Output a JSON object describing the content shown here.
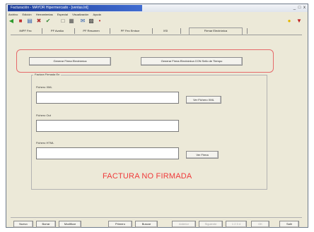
{
  "window": {
    "title": "Facturación - MAYOR Hipermercado - [ventas.lnl]",
    "controls": "_ □ x"
  },
  "menu": [
    "Archivo",
    "Edición",
    "Herramientas",
    "Especial",
    "Visualización",
    "Ayuda"
  ],
  "toolbar_icons": [
    "back-icon",
    "stop-icon",
    "print-icon",
    "delete-icon",
    "check-icon"
  ],
  "tabs": [
    {
      "label": "IMPF Fec"
    },
    {
      "label": "PF Avalúo"
    },
    {
      "label": "PF Resumen"
    },
    {
      "label": "PF Fec Emisor"
    },
    {
      "label": "XSI"
    },
    {
      "label": "Firmar Electrónica"
    }
  ],
  "signing": {
    "btn_generate": "Generar Firma Electrónica",
    "btn_generate_ts": "Generar Firma Electrónica CON Sello de Tiempo"
  },
  "group": {
    "title": "Factura Firmada En",
    "fields": [
      {
        "label": "Fichero XML",
        "value": "",
        "button": "Ver Fichero XML"
      },
      {
        "label": "Fichero Out",
        "value": ""
      },
      {
        "label": "Fichero HTML",
        "value": "",
        "button": "Ver Firma"
      }
    ]
  },
  "status_text": "FACTURA NO FIRMADA",
  "bottom_buttons": [
    {
      "label": "Nuevo",
      "enabled": true
    },
    {
      "label": "Borrar",
      "enabled": true
    },
    {
      "label": "Modificar",
      "enabled": true
    },
    {
      "label": "Primero",
      "enabled": true
    },
    {
      "label": "Buscar",
      "enabled": true
    },
    {
      "label": "Anterior",
      "enabled": false
    },
    {
      "label": "Siguiente",
      "enabled": false
    },
    {
      "label": "1 2 3 4",
      "enabled": false
    },
    {
      "label": "OK",
      "enabled": false
    },
    {
      "label": "Salir",
      "enabled": true
    }
  ],
  "colors": {
    "highlight": "#e66a6a",
    "status_text": "#ef3a3a",
    "title_bar": "#2a4fb0"
  }
}
